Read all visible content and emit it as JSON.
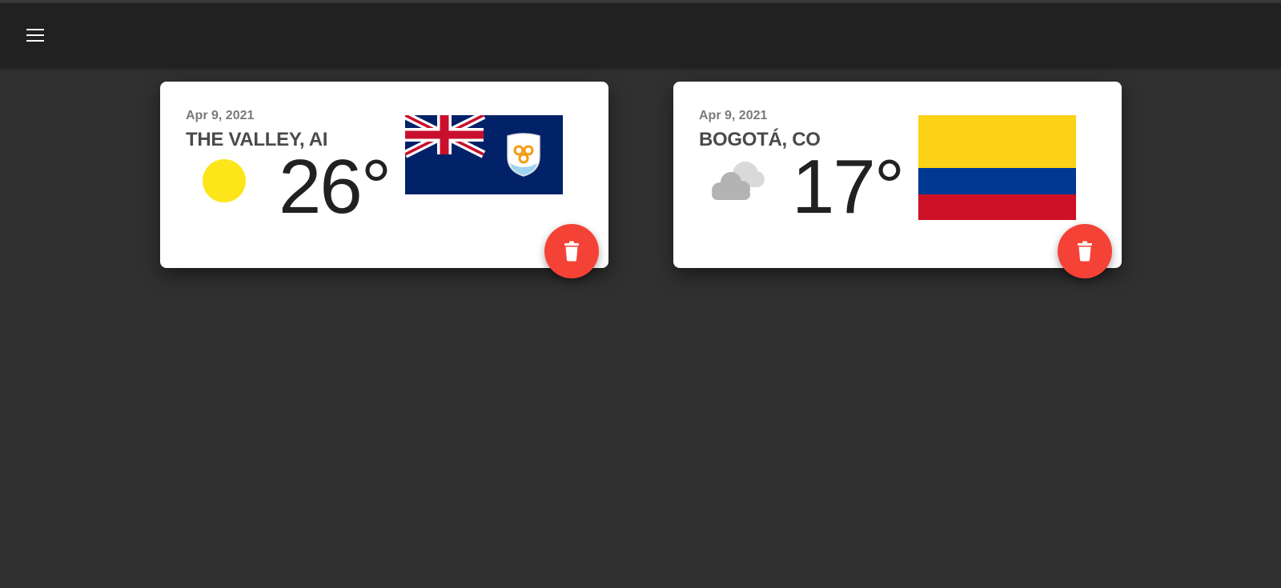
{
  "appbar": {
    "menu_icon": "menu-icon"
  },
  "cards": [
    {
      "date": "Apr 9, 2021",
      "city": "THE VALLEY, AI",
      "temperature": "26°",
      "weather_icon": "sun-icon",
      "flag": "anguilla-flag",
      "delete_icon": "trash-icon"
    },
    {
      "date": "Apr 9, 2021",
      "city": "BOGOTÁ, CO",
      "temperature": "17°",
      "weather_icon": "cloud-icon",
      "flag": "colombia-flag",
      "delete_icon": "trash-icon"
    }
  ],
  "colors": {
    "background": "#303030",
    "appbar": "#212121",
    "delete_button": "#f44336",
    "sun": "#fce61a"
  }
}
